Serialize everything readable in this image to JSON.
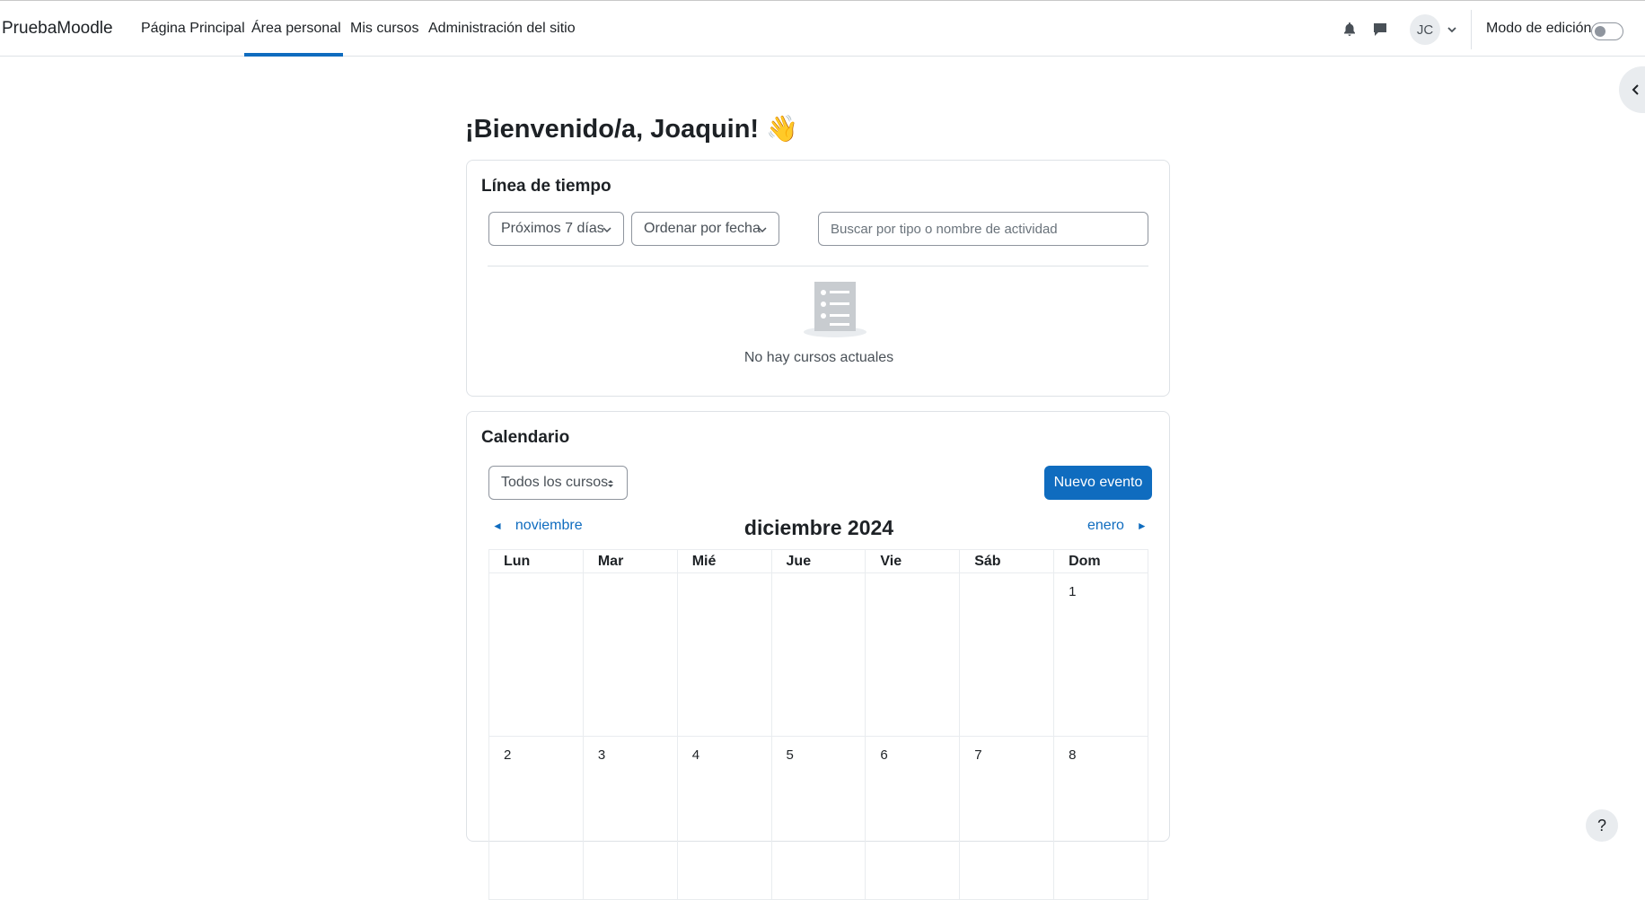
{
  "navbar": {
    "brand": "PruebaMoodle",
    "links": [
      "Página Principal",
      "Área personal",
      "Mis cursos",
      "Administración del sitio"
    ],
    "avatar_initials": "JC",
    "edit_mode_label": "Modo de edición"
  },
  "main": {
    "welcome": "¡Bienvenido/a, Joaquin! 👋"
  },
  "timeline": {
    "title": "Línea de tiempo",
    "filter_label": "Próximos 7 días",
    "sort_label": "Ordenar por fecha",
    "search_placeholder": "Buscar por tipo o nombre de actividad",
    "empty_text": "No hay cursos actuales"
  },
  "calendar": {
    "title": "Calendario",
    "course_filter": "Todos los cursos",
    "new_event_label": "Nuevo evento",
    "prev_month": "noviembre",
    "next_month": "enero",
    "month_title": "diciembre 2024",
    "weekdays": [
      "Lun",
      "Mar",
      "Mié",
      "Jue",
      "Vie",
      "Sáb",
      "Dom"
    ],
    "weeks": [
      [
        "",
        "",
        "",
        "",
        "",
        "",
        "1"
      ],
      [
        "2",
        "3",
        "4",
        "5",
        "6",
        "7",
        "8"
      ]
    ]
  },
  "help": {
    "label": "?"
  },
  "colors": {
    "primary": "#0f6cbf",
    "text": "#1d2125",
    "muted": "#495057",
    "border": "#dee2e6"
  }
}
